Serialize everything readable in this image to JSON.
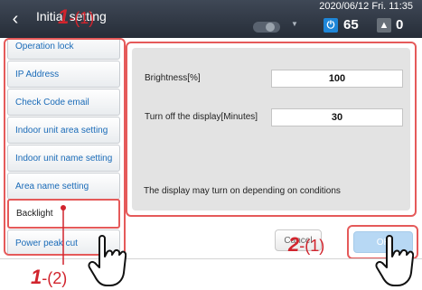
{
  "header": {
    "title": "Initial setting",
    "datetime": "2020/06/12 Fri. 11:35",
    "power_icon": "power-icon",
    "power_count": "65",
    "warning_icon": "warning-icon",
    "warning_count": "0"
  },
  "sidebar": {
    "items": [
      {
        "label": "Operation lock"
      },
      {
        "label": "IP Address"
      },
      {
        "label": "Check Code email address"
      },
      {
        "label": "Indoor unit area setting"
      },
      {
        "label": "Indoor unit name setting"
      },
      {
        "label": "Area name setting"
      },
      {
        "label": "Backlight"
      },
      {
        "label": "Power peak cut"
      }
    ],
    "selected": "Backlight"
  },
  "settings": {
    "brightness_label": "Brightness[%]",
    "brightness_value": "100",
    "turnoff_label": "Turn off the display[Minutes]",
    "turnoff_value": "30",
    "note": "The display may turn on depending on conditions"
  },
  "buttons": {
    "cancel": "Cancel",
    "ok": "OK"
  },
  "annotations": {
    "a1_num": "1",
    "a1_sub": "-(1)",
    "a2_num": "1",
    "a2_sub": "-(2)",
    "a3_num": "2",
    "a3_sub": "-(1)"
  },
  "colors": {
    "highlight": "#e55a5a",
    "annotation": "#d1242d",
    "header": "#2f3642",
    "link": "#1a6bb8",
    "ok_button": "#b7d8f4"
  }
}
